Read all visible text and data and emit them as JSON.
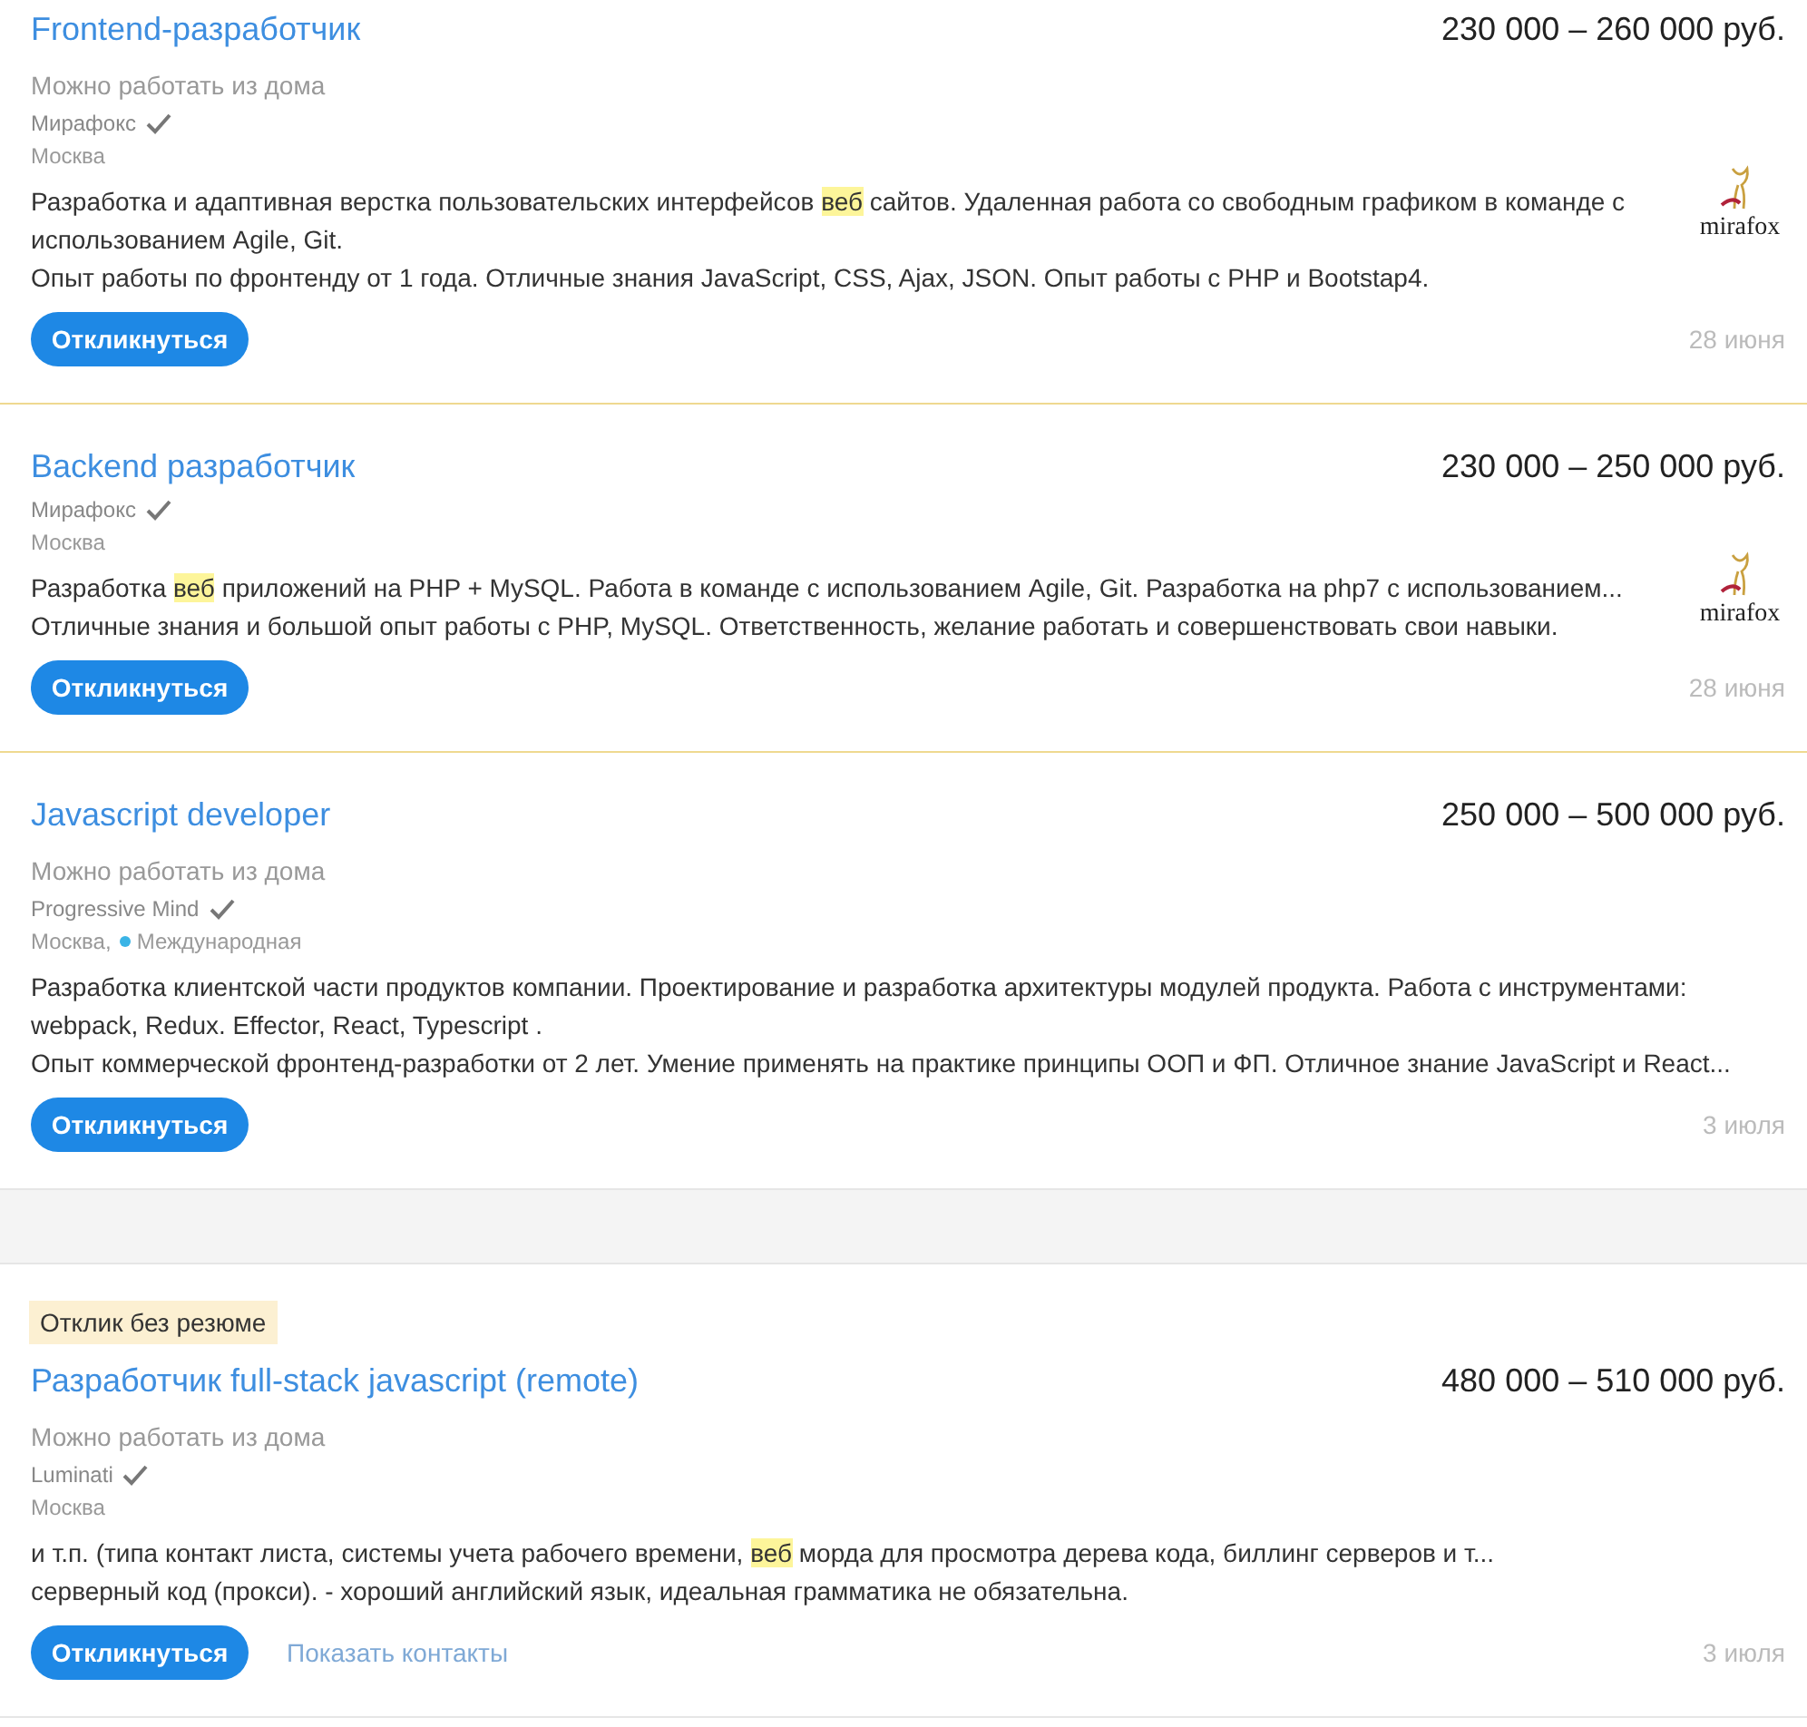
{
  "vacancies": [
    {
      "title": "Frontend-разработчик",
      "salary": "230 000 – 260 000 руб.",
      "remote": "Можно работать из дома",
      "company": "Мирафокс",
      "verified": true,
      "location": "Москва",
      "premium": true,
      "paragraphs": [
        [
          {
            "text": "Разработка и адаптивная верстка пользовательских интерфейсов ",
            "highlighted": false
          },
          {
            "text": "веб",
            "highlighted": true
          },
          {
            "text": " сайтов. Удаленная работа со свободным графиком в команде с использованием Agile, Git.",
            "highlighted": false
          }
        ],
        [
          {
            "text": "Опыт работы по фронтенду от 1 года. Отличные знания JavaScript, CSS, Ajax, JSON. Опыт работы с PHP и Bootstap4.",
            "highlighted": false
          }
        ]
      ],
      "logo": {
        "text": "mirafox"
      },
      "button": "Откликнуться",
      "date": "28 июня"
    },
    {
      "title": "Backend разработчик",
      "salary": "230 000 – 250 000 руб.",
      "company": "Мирафокс",
      "verified": true,
      "location": "Москва",
      "premium": true,
      "paragraphs": [
        [
          {
            "text": "Разработка ",
            "highlighted": false
          },
          {
            "text": "веб",
            "highlighted": true
          },
          {
            "text": " приложений на PHP + MySQL. Работа в команде с использованием Agile, Git. Разработка на php7 с использованием...",
            "highlighted": false
          }
        ],
        [
          {
            "text": "Отличные знания и большой опыт работы с PHP, MySQL. Ответственность, желание работать и совершенствовать свои навыки.",
            "highlighted": false
          }
        ]
      ],
      "logo": {
        "text": "mirafox"
      },
      "button": "Откликнуться",
      "date": "28 июня"
    },
    {
      "title": "Javascript developer",
      "salary": "250 000 – 500 000 руб.",
      "remote": "Можно работать из дома",
      "company": "Progressive Mind",
      "verified": true,
      "location": "Москва,",
      "region": {
        "name": "Международная",
        "color": "#3ab4e6"
      },
      "premium": false,
      "paragraphs": [
        [
          {
            "text": "Разработка клиентской части продуктов компании. Проектирование и разработка архитектуры модулей продукта. Работа с инструментами: webpack, Redux. Effector, React, Typescript .",
            "highlighted": false
          }
        ],
        [
          {
            "text": "Опыт коммерческой фронтенд-разработки от 2 лет. Умение применять на практике принципы ООП и ФП. Отличное знание JavaScript и React...",
            "highlighted": false
          }
        ]
      ],
      "button": "Откликнуться",
      "date": "3 июля"
    },
    {
      "badge": "Отклик без резюме",
      "title": "Разработчик full-stack javascript (remote)",
      "salary": "480 000 – 510 000 руб.",
      "remote": "Можно работать из дома",
      "company": "Luminati",
      "verified": true,
      "location": "Москва",
      "premium": false,
      "paragraphs": [
        [
          {
            "text": "и т.п. (типа контакт листа, системы учета рабочего времени, ",
            "highlighted": false
          },
          {
            "text": "веб",
            "highlighted": true
          },
          {
            "text": " морда для просмотра дерева кода, биллинг серверов и т...",
            "highlighted": false
          }
        ],
        [
          {
            "text": "серверный код (прокси). - хороший английский язык, идеальная грамматика не обязательна.",
            "highlighted": false
          }
        ]
      ],
      "button": "Откликнуться",
      "contacts": "Показать контакты",
      "date": "3 июля"
    }
  ]
}
